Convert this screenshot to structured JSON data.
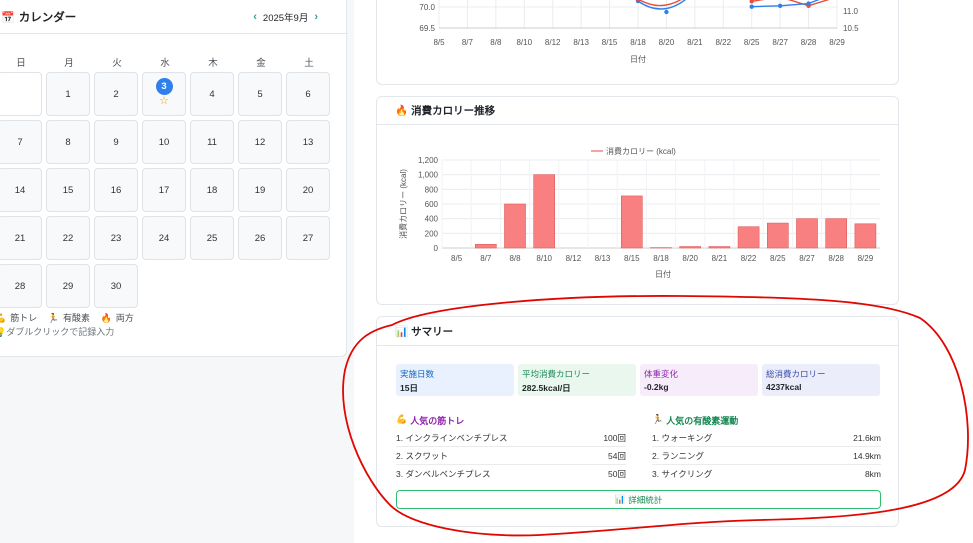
{
  "calendar": {
    "title": "カレンダー",
    "month": "2025年9月",
    "prev": "‹",
    "next": "›",
    "weekdays": [
      "日",
      "月",
      "火",
      "水",
      "木",
      "金",
      "土"
    ],
    "days": [
      "1",
      "2",
      "3",
      "4",
      "5",
      "6",
      "7",
      "8",
      "9",
      "10",
      "11",
      "12",
      "13",
      "14",
      "15",
      "16",
      "17",
      "18",
      "19",
      "20",
      "21",
      "22",
      "23",
      "24",
      "25",
      "26",
      "27",
      "28",
      "29",
      "30"
    ],
    "today": "3",
    "legend": {
      "strength": "筋トレ",
      "cardio": "有酸素",
      "both": "両方"
    },
    "hint": "ダブルクリックで記録入力"
  },
  "weight_chart": {
    "xlabel": "日付",
    "categories": [
      "8/5",
      "8/7",
      "8/8",
      "8/10",
      "8/12",
      "8/13",
      "8/15",
      "8/18",
      "8/20",
      "8/21",
      "8/22",
      "8/25",
      "8/27",
      "8/28",
      "8/29"
    ],
    "y_left_ticks": [
      "70.0",
      "69.5"
    ],
    "y_right_ticks": [
      "11.0",
      "10.5"
    ],
    "series": [
      {
        "color": "#e74c3c",
        "values": [
          null,
          null,
          null,
          null,
          null,
          null,
          null,
          null,
          null,
          null,
          null,
          11.1,
          11.2,
          11.0,
          11.2
        ]
      },
      {
        "color": "#2f80ed",
        "values": [
          null,
          null,
          null,
          null,
          null,
          null,
          null,
          null,
          null,
          null,
          null,
          10.98,
          11.0,
          11.05,
          11.3
        ]
      }
    ]
  },
  "calorie_chart": {
    "title": "消費カロリー推移",
    "chart_data": {
      "type": "bar",
      "legend": "消費カロリー (kcal)",
      "ylabel": "消費カロリー (kcal)",
      "xlabel": "日付",
      "categories": [
        "8/5",
        "8/7",
        "8/8",
        "8/10",
        "8/12",
        "8/13",
        "8/15",
        "8/18",
        "8/20",
        "8/21",
        "8/22",
        "8/25",
        "8/27",
        "8/28",
        "8/29"
      ],
      "values": [
        0,
        50,
        600,
        1000,
        0,
        0,
        710,
        5,
        20,
        20,
        290,
        340,
        400,
        400,
        330
      ],
      "yticks": [
        "0",
        "200",
        "400",
        "600",
        "800",
        "1,000",
        "1,200"
      ],
      "ylim": [
        0,
        1200
      ],
      "color": "#f98080"
    }
  },
  "summary": {
    "title": "サマリー",
    "stats": [
      {
        "label": "実施日数",
        "value": "15日",
        "color": "#1565c0",
        "bg": "#e8f1fd"
      },
      {
        "label": "平均消費カロリー",
        "value": "282.5kcal/日",
        "color": "#198754",
        "bg": "#e9f7ef"
      },
      {
        "label": "体重変化",
        "value": "-0.2kg",
        "color": "#8e24aa",
        "bg": "#f6ecfa"
      },
      {
        "label": "総消費カロリー",
        "value": "4237kcal",
        "color": "#3949ab",
        "bg": "#ebeefa"
      }
    ],
    "strength_title": "人気の筋トレ",
    "strength": [
      {
        "name": "1. インクラインベンチプレス",
        "count": "100回"
      },
      {
        "name": "2. スクワット",
        "count": "54回"
      },
      {
        "name": "3. ダンベルベンチプレス",
        "count": "50回"
      }
    ],
    "cardio_title": "人気の有酸素運動",
    "cardio": [
      {
        "name": "1. ウォーキング",
        "dist": "21.6km"
      },
      {
        "name": "2. ランニング",
        "dist": "14.9km"
      },
      {
        "name": "3. サイクリング",
        "dist": "8km"
      }
    ],
    "detail_button": "詳細統計"
  }
}
